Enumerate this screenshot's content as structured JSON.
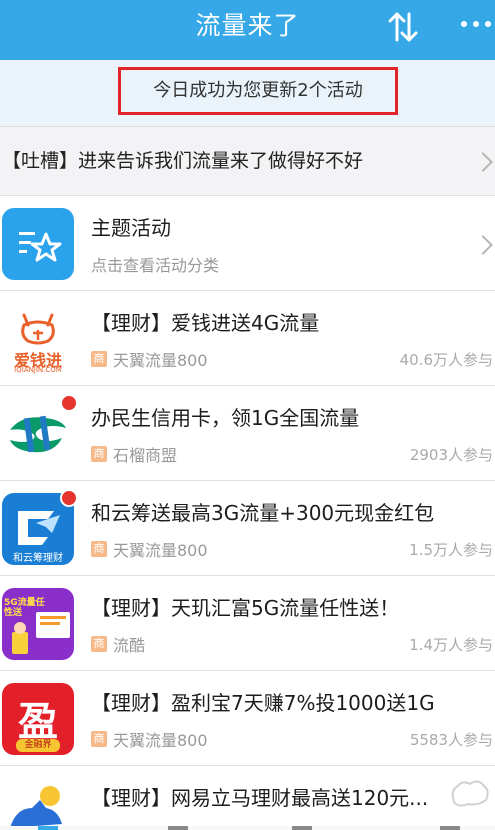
{
  "header": {
    "title": "流量来了",
    "sort_icon": "sort-arrows-icon",
    "more_icon": "more-dots-icon"
  },
  "notice": {
    "text": "今日成功为您更新2个活动"
  },
  "feedback": {
    "text": "【吐槽】进来告诉我们流量来了做得好不好"
  },
  "theme": {
    "title": "主题活动",
    "subtitle": "点击查看活动分类"
  },
  "items": [
    {
      "title": "【理财】爱钱进送4G流量",
      "tag": "商",
      "source": "天翼流量800",
      "count": "40.6万人参与",
      "icon_caption": "爱钱进",
      "icon_sub": "IQIANJIN.COM"
    },
    {
      "title": "办民生信用卡，领1G全国流量",
      "tag": "商",
      "source": "石榴商盟",
      "count": "2903人参与"
    },
    {
      "title": "和云筹送最高3G流量+300元现金红包",
      "tag": "商",
      "source": "天翼流量800",
      "count": "1.5万人参与",
      "icon_caption": "和云筹理财"
    },
    {
      "title": "【理财】天玑汇富5G流量任性送！",
      "tag": "商",
      "source": "流酷",
      "count": "1.4万人参与",
      "icon_caption": "5G流量任性送"
    },
    {
      "title": "【理财】盈利宝7天赚7%投1000送1G",
      "tag": "商",
      "source": "天翼流量800",
      "count": "5583人参与",
      "icon_caption": "盈",
      "icon_sub": "金融界"
    },
    {
      "title": "【理财】网易立马理财最高送120元..."
    }
  ],
  "colors": {
    "header_bg": "#36a8e8",
    "notice_border": "#e2242a",
    "badge": "#e8342f"
  }
}
